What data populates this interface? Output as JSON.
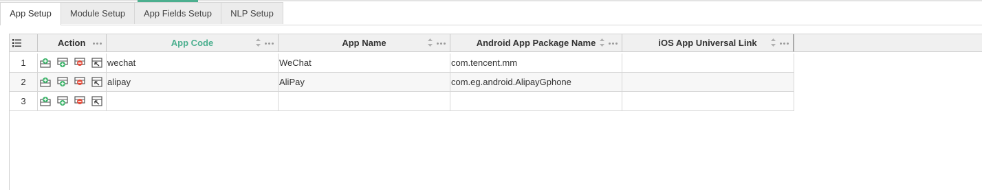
{
  "tabs": [
    {
      "label": "App Setup",
      "active": true
    },
    {
      "label": "Module Setup",
      "active": false
    },
    {
      "label": "App Fields Setup",
      "active": false
    },
    {
      "label": "NLP Setup",
      "active": false
    }
  ],
  "grid": {
    "columns": {
      "action": "Action",
      "app_code": "App Code",
      "app_name": "App Name",
      "android_package": "Android App Package Name",
      "ios_link": "iOS App Universal Link"
    },
    "rows": [
      {
        "num": "1",
        "app_code": "wechat",
        "app_name": "WeChat",
        "android_package": "com.tencent.mm",
        "ios_link": ""
      },
      {
        "num": "2",
        "app_code": "alipay",
        "app_name": "AliPay",
        "android_package": "com.eg.android.AlipayGphone",
        "ios_link": ""
      },
      {
        "num": "3",
        "app_code": "",
        "app_name": "",
        "android_package": "",
        "ios_link": ""
      }
    ],
    "row_actions": [
      "insert-row-icon",
      "add-row-icon",
      "delete-row-icon",
      "edit-row-icon"
    ]
  },
  "colors": {
    "accent": "#4caf8f",
    "delete": "#e24c3b",
    "header_bg": "#f0f0f0"
  }
}
